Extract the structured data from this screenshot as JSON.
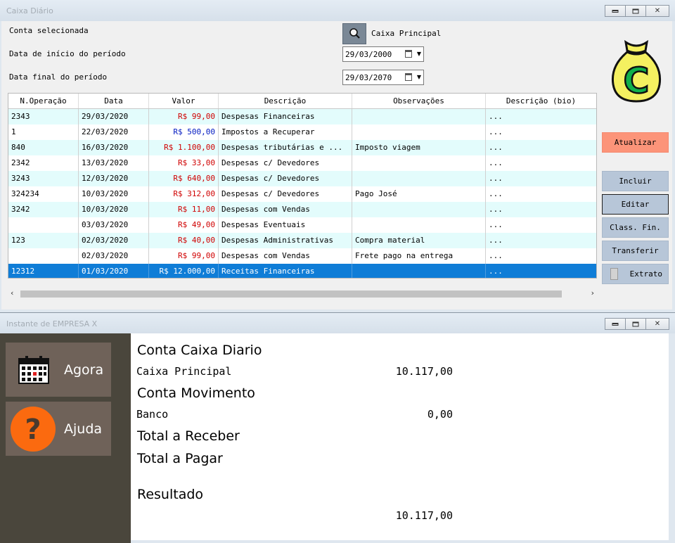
{
  "window1": {
    "title": "Caixa Diário",
    "fields": {
      "conta_label": "Conta selecionada",
      "conta_value": "Caixa Principal",
      "inicio_label": "Data de início do período",
      "inicio_value": "29/03/2000",
      "final_label": "Data final do período",
      "final_value": "29/03/2070"
    },
    "columns": [
      "N.Operação",
      "Data",
      "Valor",
      "Descrição",
      "Observações",
      "Descrição (bio)"
    ],
    "rows": [
      [
        "2343",
        "29/03/2020",
        "R$ 99,00",
        "Despesas Financeiras",
        "",
        "..."
      ],
      [
        "1",
        "22/03/2020",
        "R$ 500,00",
        "Impostos a Recuperar",
        "",
        "..."
      ],
      [
        "840",
        "16/03/2020",
        "R$ 1.100,00",
        "Despesas tributárias e ...",
        "Imposto viagem",
        "..."
      ],
      [
        "2342",
        "13/03/2020",
        "R$ 33,00",
        "Despesas c/ Devedores",
        "",
        "..."
      ],
      [
        "3243",
        "12/03/2020",
        "R$ 640,00",
        "Despesas c/ Devedores",
        "",
        "..."
      ],
      [
        "324234",
        "10/03/2020",
        "R$ 312,00",
        "Despesas c/ Devedores",
        "Pago José",
        "..."
      ],
      [
        "3242",
        "10/03/2020",
        "R$ 11,00",
        "Despesas com Vendas",
        "",
        "..."
      ],
      [
        "",
        "03/03/2020",
        "R$ 49,00",
        "Despesas Eventuais",
        "",
        "..."
      ],
      [
        "123",
        "02/03/2020",
        "R$ 40,00",
        "Despesas Administrativas",
        "Compra material",
        "..."
      ],
      [
        "",
        "02/03/2020",
        "R$ 99,00",
        "Despesas com Vendas",
        "Frete pago na entrega",
        "..."
      ],
      [
        "12312",
        "01/03/2020",
        "R$ 12.000,00",
        "Receitas Financeiras",
        "",
        "..."
      ]
    ],
    "buttons": {
      "atualizar": "Atualizar",
      "incluir": "Incluir",
      "editar": "Editar",
      "class_fin": "Class. Fin.",
      "transferir": "Transferir",
      "extrato": "Extrato"
    },
    "logo_letter": "C",
    "colors": {
      "negative": "#d00000",
      "positive": "#0018c0",
      "selection": "#0f7dd7",
      "accent": "#fc9479"
    }
  },
  "window2": {
    "title": "Instante de EMPRESA X",
    "tiles": {
      "agora": "Agora",
      "ajuda": "Ajuda"
    },
    "ajuda_glyph": "?",
    "summary": {
      "caixa_heading": "Conta Caixa Diario",
      "caixa_label": "Caixa Principal",
      "caixa_value": "10.117,00",
      "movimento_heading": "Conta Movimento",
      "banco_label": "Banco",
      "banco_value": "0,00",
      "receber_heading": "Total a Receber",
      "pagar_heading": "Total a Pagar",
      "resultado_heading": "Resultado",
      "resultado_value": "10.117,00"
    }
  }
}
